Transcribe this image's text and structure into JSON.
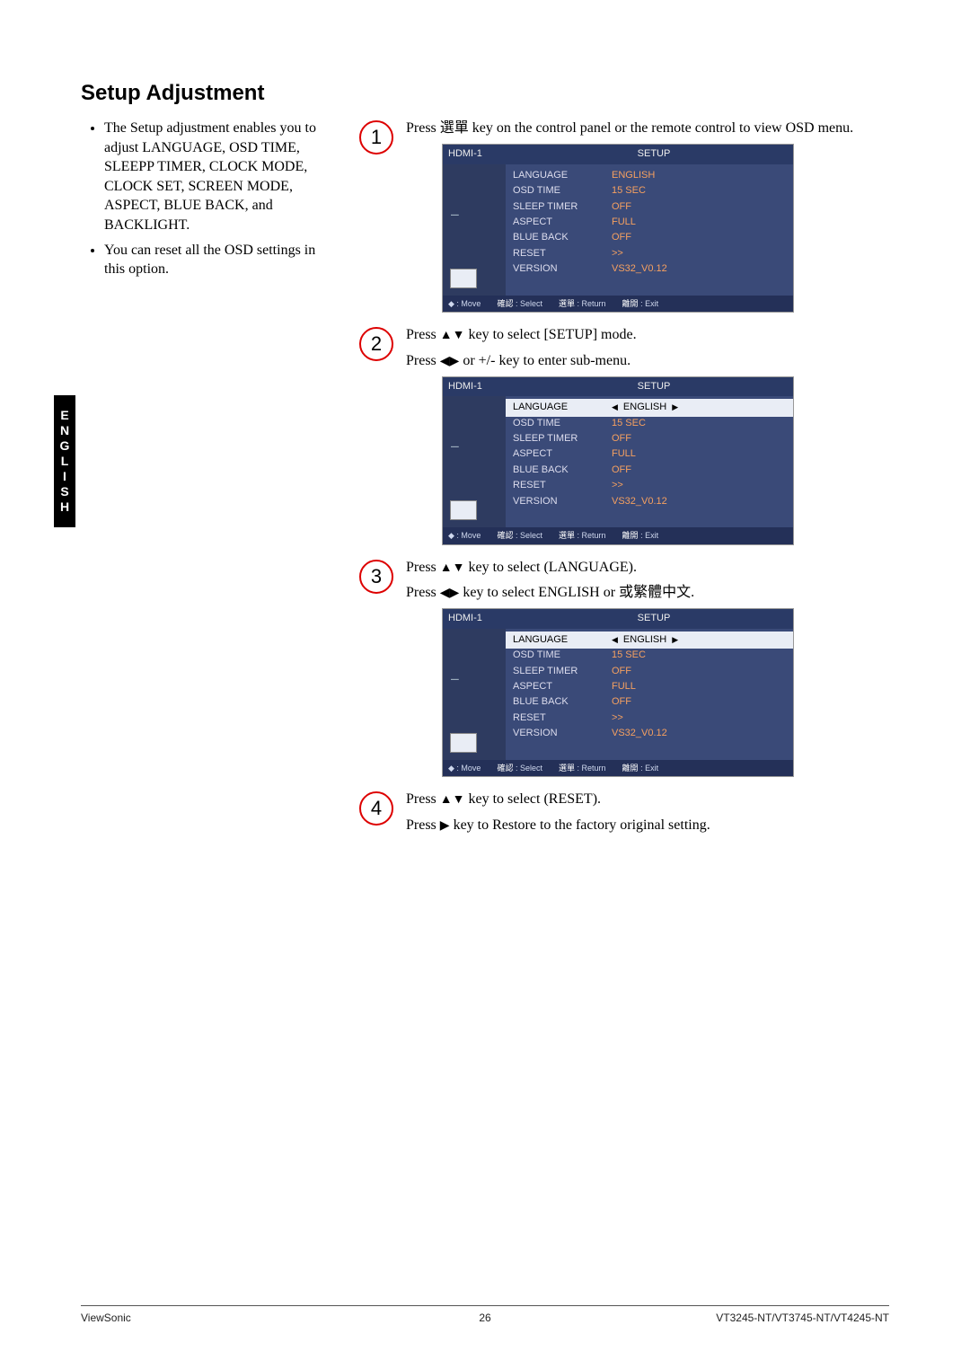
{
  "lang_tab": "ENGLISH",
  "title": "Setup Adjustment",
  "bullets": [
    "The Setup adjustment enables you to adjust LANGUAGE, OSD TIME, SLEEPP TIMER, CLOCK MODE, CLOCK SET, SCREEN MODE, ASPECT, BLUE BACK, and BACKLIGHT.",
    "You can reset all the OSD settings in this option."
  ],
  "steps": {
    "s1": {
      "num": "1",
      "line1_a": "Press ",
      "line1_key": "選單",
      "line1_b": " key on the control panel or the remote control to view OSD menu."
    },
    "s2": {
      "num": "2",
      "line1_a": "Press ",
      "line1_arrows": "▲▼",
      "line1_b": " key to select [SETUP] mode.",
      "line2_a": "Press ",
      "line2_arrows": "◀▶",
      "line2_b": " or +/- key to enter sub-menu."
    },
    "s3": {
      "num": "3",
      "line1_a": "Press ",
      "line1_arrows": "▲▼",
      "line1_b": " key to select (LANGUAGE).",
      "line2_a": "Press ",
      "line2_arrows": "◀▶",
      "line2_b": " key to select ENGLISH or 或繁體中文."
    },
    "s4": {
      "num": "4",
      "line1_a": "Press ",
      "line1_arrows": "▲▼",
      "line1_b": " key to select (RESET).",
      "line2_a": "Press ",
      "line2_arrows": "▶",
      "line2_b": " key to Restore to the factory original setting."
    }
  },
  "osd": {
    "source": "HDMI-1",
    "title": "SETUP",
    "rows": [
      {
        "label": "LANGUAGE",
        "value": "ENGLISH"
      },
      {
        "label": "OSD TIME",
        "value": "15 SEC"
      },
      {
        "label": "SLEEP TIMER",
        "value": "OFF"
      },
      {
        "label": "ASPECT",
        "value": "FULL"
      },
      {
        "label": "BLUE BACK",
        "value": "OFF"
      },
      {
        "label": "RESET",
        "value": ">>"
      },
      {
        "label": "VERSION",
        "value": "VS32_V0.12"
      }
    ],
    "footer": {
      "move": ": Move",
      "select_k": "確認",
      "select": ": Select",
      "return_k": "選單",
      "return": ": Return",
      "exit_k": "離開",
      "exit": ": Exit"
    },
    "nav_tool": "⚊"
  },
  "footer": {
    "left": "ViewSonic",
    "center": "26",
    "right": "VT3245-NT/VT3745-NT/VT4245-NT"
  }
}
